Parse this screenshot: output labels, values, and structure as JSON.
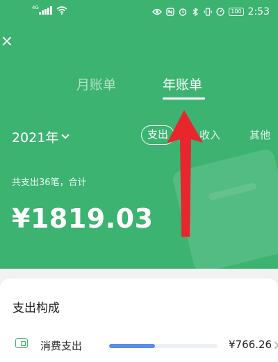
{
  "status_bar": {
    "network_type": "4G",
    "battery": "100",
    "time": "2:53"
  },
  "header": {
    "close_icon": "×",
    "tabs": [
      {
        "label": "月账单",
        "active": false
      },
      {
        "label": "年账单",
        "active": true
      }
    ],
    "year_select": "2021年",
    "filters": [
      {
        "label": "支出",
        "active": true
      },
      {
        "label": "收入",
        "active": false
      },
      {
        "label": "其他",
        "active": false
      }
    ],
    "summary": "共支出36笔，合计",
    "total": "¥1819.03"
  },
  "breakdown": {
    "title": "支出构成",
    "items": [
      {
        "label": "消费支出",
        "amount": "¥766.26",
        "share": 0.42,
        "icon": "wallet-icon"
      }
    ]
  },
  "colors": {
    "header_green": "#3cb371",
    "bar_blue": "#5b8de8",
    "arrow_red": "#e8262d"
  }
}
